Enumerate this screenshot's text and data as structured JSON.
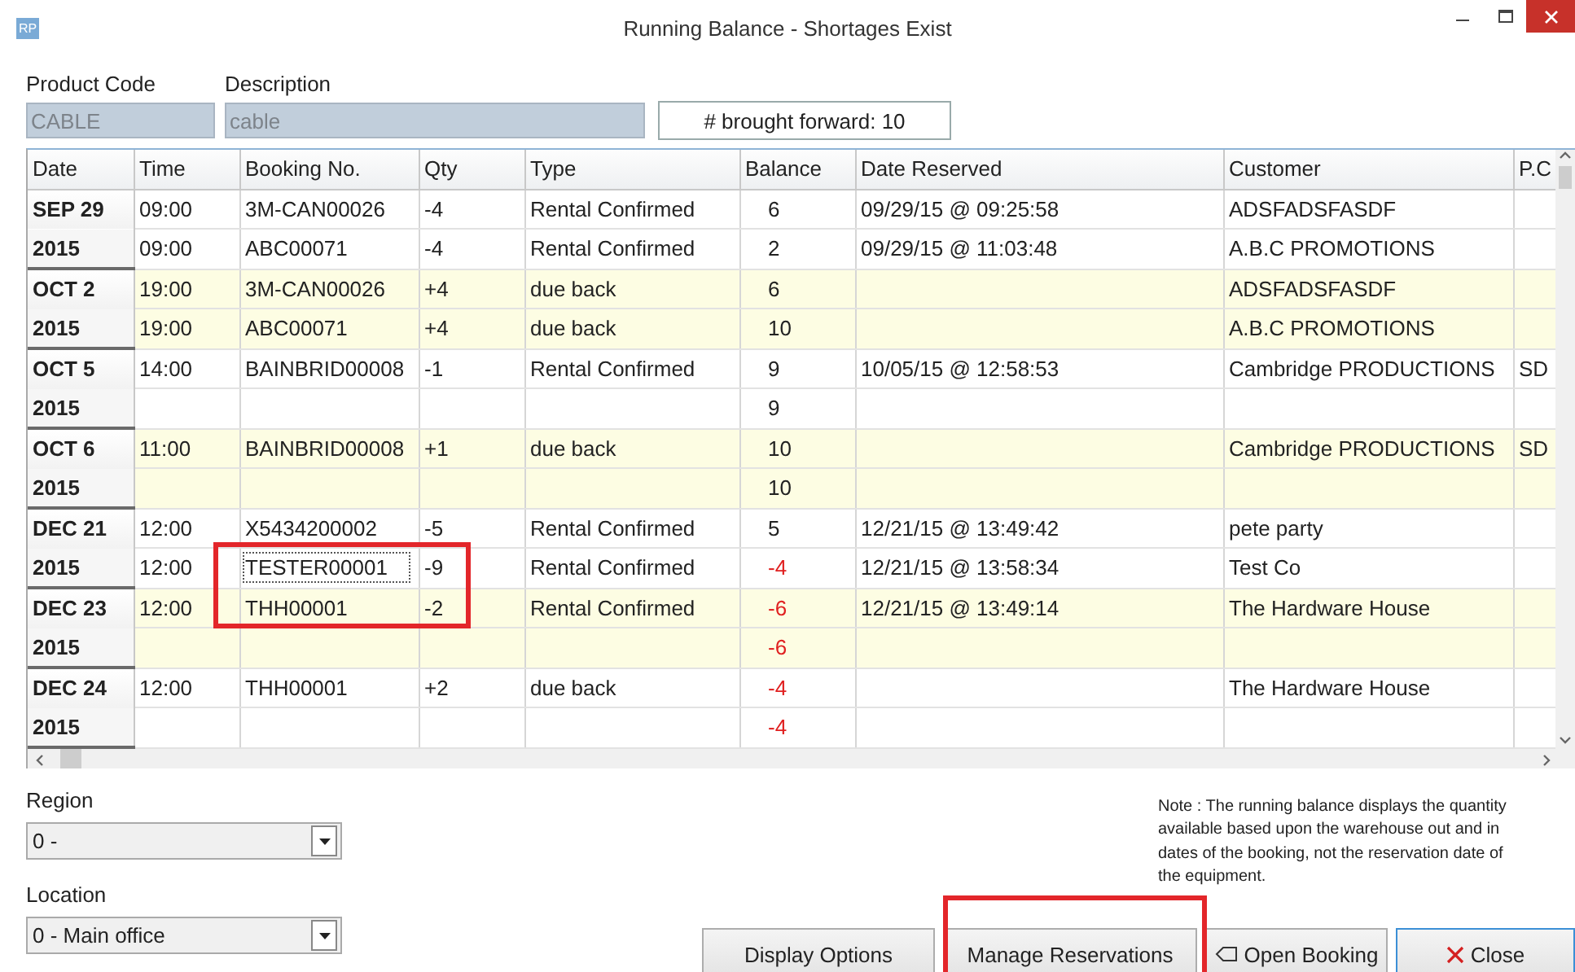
{
  "window": {
    "icon_text": "RP",
    "title": "Running Balance - Shortages Exist"
  },
  "product_code": {
    "label": "Product Code",
    "value": "CABLE",
    "disabled": true
  },
  "description": {
    "label": "Description",
    "value": "cable",
    "disabled": true
  },
  "brought_forward": "# brought forward: 10",
  "table": {
    "columns": [
      "Date",
      "Time",
      "Booking No.",
      "Qty",
      "Type",
      "Balance",
      "Date Reserved",
      "Customer",
      "P.C"
    ],
    "groups": [
      {
        "date": "SEP 29",
        "year": "2015",
        "rows": [
          {
            "time": "09:00",
            "booking": "3M-CAN00026",
            "qty": "-4",
            "type": "Rental Confirmed",
            "balance": "6",
            "shortage": false,
            "date_reserved": "09/29/15 @ 09:25:58",
            "customer": "ADSFADSFASDF"
          },
          {
            "time": "09:00",
            "booking": "ABC00071",
            "qty": "-4",
            "type": "Rental Confirmed",
            "balance": "2",
            "shortage": false,
            "date_reserved": "09/29/15 @ 11:03:48",
            "customer": "A.B.C PROMOTIONS"
          }
        ]
      },
      {
        "date": "OCT 2",
        "year": "2015",
        "rows": [
          {
            "time": "19:00",
            "booking": "3M-CAN00026",
            "qty": "+4",
            "type": "due back",
            "balance": "6",
            "shortage": false,
            "customer": "ADSFADSFASDF"
          },
          {
            "time": "19:00",
            "booking": "ABC00071",
            "qty": "+4",
            "type": "due back",
            "balance": "10",
            "shortage": false,
            "customer": "A.B.C PROMOTIONS"
          }
        ]
      },
      {
        "date": "OCT 5",
        "year": "2015",
        "rows": [
          {
            "time": "14:00",
            "booking": "BAINBRID00008",
            "qty": "-1",
            "type": "Rental Confirmed",
            "balance": "9",
            "shortage": false,
            "date_reserved": "10/05/15 @ 12:58:53",
            "customer": "Cambridge PRODUCTIONS",
            "po": "SD"
          },
          {
            "balance": "9",
            "shortage": false
          }
        ]
      },
      {
        "date": "OCT 6",
        "year": "2015",
        "rows": [
          {
            "time": "11:00",
            "booking": "BAINBRID00008",
            "qty": "+1",
            "type": "due back",
            "balance": "10",
            "shortage": false,
            "customer": "Cambridge PRODUCTIONS",
            "po": "SD"
          },
          {
            "balance": "10",
            "shortage": false
          }
        ]
      },
      {
        "date": "DEC 21",
        "year": "2015",
        "rows": [
          {
            "time": "12:00",
            "booking": "X5434200002",
            "qty": "-5",
            "type": "Rental Confirmed",
            "balance": "5",
            "shortage": false,
            "date_reserved": "12/21/15 @ 13:49:42",
            "customer": "pete party"
          },
          {
            "time": "12:00",
            "booking": "TESTER00001",
            "focused": true,
            "qty": "-9",
            "type": "Rental Confirmed",
            "balance": "-4",
            "shortage": true,
            "date_reserved": "12/21/15 @ 13:58:34",
            "customer": "Test Co"
          }
        ]
      },
      {
        "date": "DEC 23",
        "year": "2015",
        "rows": [
          {
            "time": "12:00",
            "booking": "THH00001",
            "qty": "-2",
            "type": "Rental Confirmed",
            "balance": "-6",
            "shortage": true,
            "date_reserved": "12/21/15 @ 13:49:14",
            "customer": "The Hardware House"
          },
          {
            "balance": "-6",
            "shortage": true
          }
        ]
      },
      {
        "date": "DEC 24",
        "year": "2015",
        "rows": [
          {
            "time": "12:00",
            "booking": "THH00001",
            "qty": "+2",
            "type": "due back",
            "balance": "-4",
            "shortage": true,
            "customer": "The Hardware House"
          },
          {
            "balance": "-4",
            "shortage": true
          }
        ]
      }
    ]
  },
  "region": {
    "label": "Region",
    "value": "0 -"
  },
  "location": {
    "label": "Location",
    "value": "0 - Main office"
  },
  "note": "Note : The running balance displays the quantity available based upon the warehouse out and in dates of the booking, not the reservation date of the equipment.",
  "buttons": [
    {
      "kind": "plain",
      "label": "Display Options"
    },
    {
      "kind": "plain",
      "label": "Manage Reservations"
    },
    {
      "kind": "open",
      "label": "Open Booking"
    },
    {
      "kind": "close",
      "label": "Close"
    }
  ]
}
